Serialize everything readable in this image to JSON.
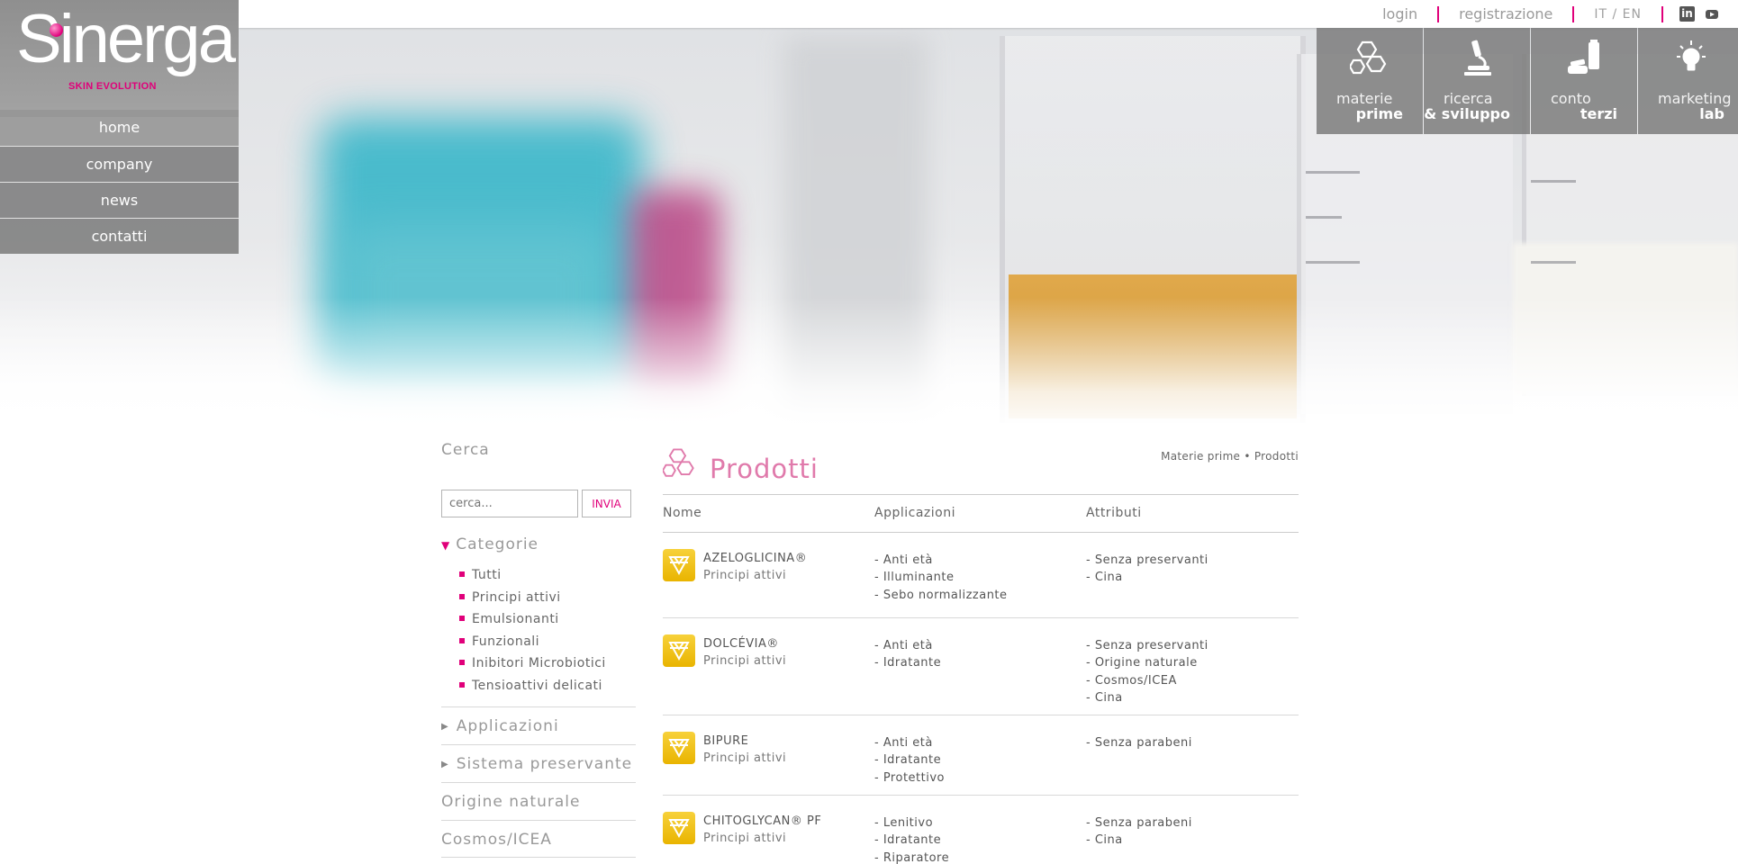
{
  "brand": {
    "logo_text": "Sinerga",
    "logo_sub": "SKIN EVOLUTION",
    "accent": "#e0007a",
    "badge_color": "#f2c21a"
  },
  "top_links": {
    "login": "login",
    "registration": "registrazione",
    "lang": "IT / EN",
    "social": [
      "linkedin-icon",
      "youtube-icon"
    ]
  },
  "main_nav": [
    "home",
    "company",
    "news",
    "contatti"
  ],
  "sections": [
    {
      "line1": "materie",
      "line2": "prime",
      "icon": "molecule-icon"
    },
    {
      "line1": "ricerca",
      "line2": "& sviluppo",
      "icon": "microscope-icon"
    },
    {
      "line1": "conto",
      "line2": "terzi",
      "icon": "cosmetic-tube-icon"
    },
    {
      "line1": "marketing",
      "line2": "lab",
      "icon": "lightbulb-icon"
    }
  ],
  "sidebar": {
    "search_title": "Cerca",
    "search_placeholder": "cerca...",
    "search_button": "INVIA",
    "categories_title": "Categorie",
    "categories": [
      "Tutti",
      "Principi attivi",
      "Emulsionanti",
      "Funzionali",
      "Inibitori Microbiotici",
      "Tensioattivi delicati"
    ],
    "accordions": [
      "Applicazioni",
      "Sistema preservante",
      "Origine naturale",
      "Cosmos/ICEA"
    ]
  },
  "products": {
    "title": "Prodotti",
    "breadcrumb": "Materie prime • Prodotti",
    "columns": [
      "Nome",
      "Applicazioni",
      "Attributi"
    ],
    "rows": [
      {
        "name": "AZELOGLICINA®",
        "category": "Principi attivi",
        "applications": [
          "- Anti età",
          "- Illuminante",
          "- Sebo normalizzante"
        ],
        "attributes": [
          "- Senza preservanti",
          "- Cina"
        ]
      },
      {
        "name": "DOLCÉVIA®",
        "category": "Principi attivi",
        "applications": [
          "- Anti età",
          "- Idratante"
        ],
        "attributes": [
          "- Senza preservanti",
          "- Origine naturale",
          "- Cosmos/ICEA",
          "- Cina"
        ]
      },
      {
        "name": "BIPURE",
        "category": "Principi attivi",
        "applications": [
          "- Anti età",
          "- Idratante",
          "- Protettivo"
        ],
        "attributes": [
          "- Senza parabeni"
        ]
      },
      {
        "name": "CHITOGLYCAN® PF",
        "category": "Principi attivi",
        "applications": [
          "- Lenitivo",
          "- Idratante",
          "- Riparatore"
        ],
        "attributes": [
          "- Senza parabeni",
          "- Cina"
        ]
      }
    ]
  }
}
